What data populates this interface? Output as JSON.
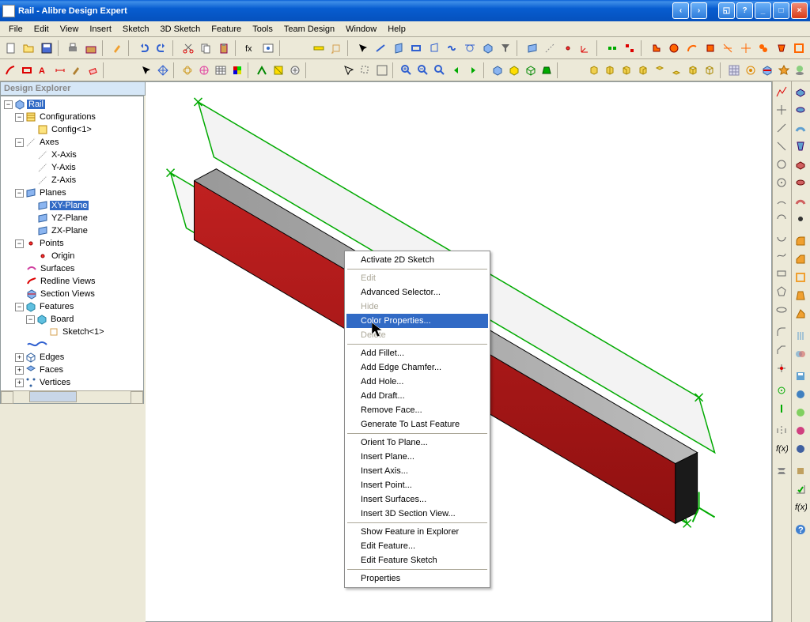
{
  "window": {
    "title": "Rail - Alibre Design Expert"
  },
  "menu": {
    "items": [
      "File",
      "Edit",
      "View",
      "Insert",
      "Sketch",
      "3D Sketch",
      "Feature",
      "Tools",
      "Team Design",
      "Window",
      "Help"
    ]
  },
  "explorer": {
    "title": "Design Explorer",
    "root": "Rail",
    "nodes": {
      "configurations": "Configurations",
      "config1": "Config<1>",
      "axes": "Axes",
      "xaxis": "X-Axis",
      "yaxis": "Y-Axis",
      "zaxis": "Z-Axis",
      "planes": "Planes",
      "xyplane": "XY-Plane",
      "yzplane": "YZ-Plane",
      "zxplane": "ZX-Plane",
      "points": "Points",
      "origin": "Origin",
      "surfaces": "Surfaces",
      "redline": "Redline Views",
      "section": "Section Views",
      "features": "Features",
      "board": "Board",
      "sketch1": "Sketch<1>",
      "edges": "Edges",
      "faces": "Faces",
      "vertices": "Vertices"
    }
  },
  "context_menu": {
    "groups": [
      [
        "Activate 2D Sketch"
      ],
      [
        "Edit",
        "Advanced Selector...",
        "Hide",
        "Color Properties...",
        "Delete"
      ],
      [
        "Add Fillet...",
        "Add Edge Chamfer...",
        "Add Hole...",
        "Add Draft...",
        "Remove Face...",
        "Generate To Last Feature"
      ],
      [
        "Orient To Plane...",
        "Insert Plane...",
        "Insert Axis...",
        "Insert Point...",
        "Insert Surfaces...",
        "Insert 3D Section View..."
      ],
      [
        "Show Feature in Explorer",
        "Edit Feature...",
        "Edit Feature Sketch"
      ],
      [
        "Properties"
      ]
    ],
    "disabled": [
      "Edit",
      "Hide",
      "Delete"
    ],
    "highlighted": "Color Properties..."
  },
  "color_legend": {
    "extrusion_body": "#a81818",
    "top_face": "#aaaaaa",
    "end_face": "#1a1a1a",
    "plane_edges": "#00aa00",
    "reference_planes": "#cccccc"
  }
}
